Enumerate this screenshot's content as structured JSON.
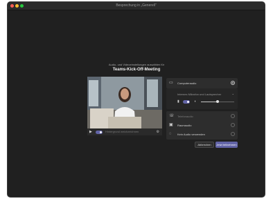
{
  "window": {
    "title": "Besprechung in „Generell“"
  },
  "prejoin": {
    "subtitle": "Audio- und Videoeinstellungen auswählen für",
    "meeting_title": "Teams-Kick-Off-Meeting"
  },
  "video_bar": {
    "camera_icon": "video-camera-icon",
    "blur_label": "Hintergrund weichzeichnen",
    "settings_icon": "gear-icon"
  },
  "audio_options": {
    "computer_audio": "Computeraudio",
    "device_selector": "Internes Mikrofon und Lautsprecher",
    "phone_audio": "Telefonaudio",
    "room_audio": "Raumaudio",
    "no_audio": "Kein Audio verwenden"
  },
  "actions": {
    "cancel_label": "Abbrechen",
    "join_label": "Jetzt teilnehmen"
  },
  "colors": {
    "accent": "#6264a7",
    "background": "#202020",
    "panel": "#2d2d2d"
  },
  "mic_enabled": true,
  "camera_enabled": true,
  "volume_level_percent": 50
}
